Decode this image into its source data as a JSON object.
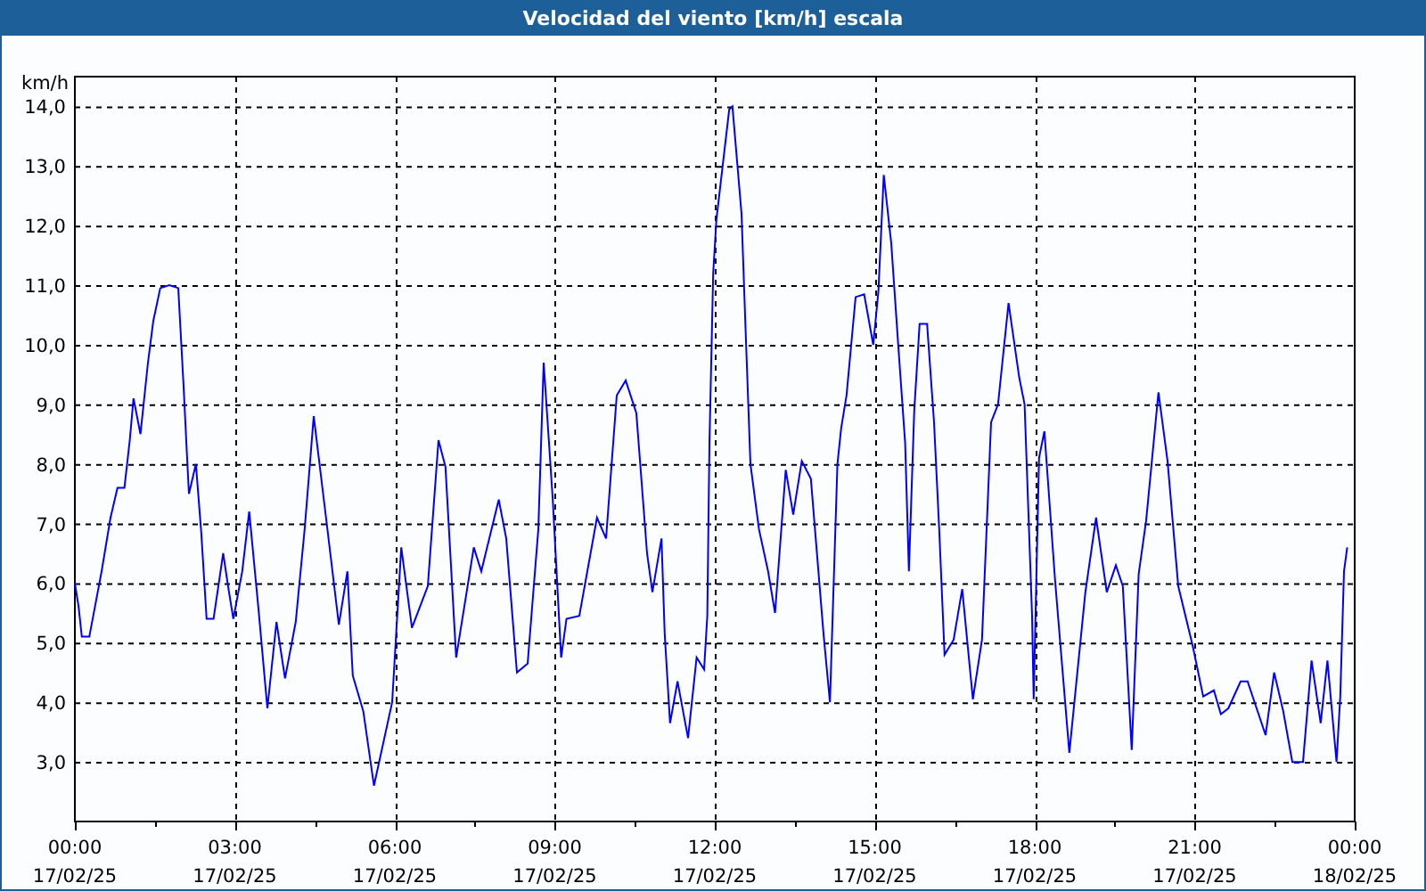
{
  "window": {
    "title": "Velocidad del viento [km/h] escala"
  },
  "chart": {
    "chart_data": {
      "type": "line",
      "ylabel": "km/h",
      "ylim": [
        2,
        14.5
      ],
      "grid": true,
      "xlim": [
        0,
        24
      ],
      "xticks": [
        {
          "value": 0,
          "label": "00:00"
        },
        {
          "value": 3,
          "label": "03:00"
        },
        {
          "value": 6,
          "label": "06:00"
        },
        {
          "value": 9,
          "label": "09:00"
        },
        {
          "value": 12,
          "label": "12:00"
        },
        {
          "value": 15,
          "label": "15:00"
        },
        {
          "value": 18,
          "label": "18:00"
        },
        {
          "value": 21,
          "label": "21:00"
        },
        {
          "value": 24,
          "label": "00:00"
        }
      ],
      "annotations": [
        "17/02/25",
        "17/02/25",
        "17/02/25",
        "17/02/25",
        "17/02/25",
        "17/02/25",
        "17/02/25",
        "17/02/25",
        "18/02/25"
      ],
      "yticks": [
        {
          "value": 3,
          "label": "3,0"
        },
        {
          "value": 4,
          "label": "4,0"
        },
        {
          "value": 5,
          "label": "5,0"
        },
        {
          "value": 6,
          "label": "6,0"
        },
        {
          "value": 7,
          "label": "7,0"
        },
        {
          "value": 8,
          "label": "8,0"
        },
        {
          "value": 9,
          "label": "9,0"
        },
        {
          "value": 10,
          "label": "10,0"
        },
        {
          "value": 11,
          "label": "11,0"
        },
        {
          "value": 12,
          "label": "12,0"
        },
        {
          "value": 13,
          "label": "13,0"
        },
        {
          "value": 14,
          "label": "14,0"
        }
      ],
      "x": [
        0,
        0.07,
        0.13,
        0.27,
        0.5,
        0.67,
        0.8,
        0.93,
        1.03,
        1.1,
        1.23,
        1.37,
        1.47,
        1.6,
        1.77,
        1.94,
        2.04,
        2.1,
        2.14,
        2.27,
        2.37,
        2.47,
        2.6,
        2.78,
        2.88,
        2.97,
        3.14,
        3.27,
        3.44,
        3.61,
        3.78,
        3.94,
        4.14,
        4.31,
        4.48,
        4.71,
        4.95,
        5.11,
        5.21,
        5.41,
        5.61,
        5.95,
        6.12,
        6.32,
        6.62,
        6.82,
        6.95,
        7.15,
        7.48,
        7.62,
        7.95,
        8.09,
        8.29,
        8.49,
        8.69,
        8.79,
        8.96,
        9.12,
        9.22,
        9.46,
        9.79,
        9.96,
        10.16,
        10.33,
        10.53,
        10.73,
        10.83,
        11.0,
        11.06,
        11.16,
        11.3,
        11.5,
        11.66,
        11.8,
        11.86,
        11.9,
        11.97,
        12.03,
        12.27,
        12.33,
        12.5,
        12.57,
        12.67,
        12.83,
        13.0,
        13.13,
        13.33,
        13.47,
        13.63,
        13.8,
        14.04,
        14.16,
        14.3,
        14.37,
        14.47,
        14.64,
        14.8,
        14.97,
        15.07,
        15.17,
        15.31,
        15.44,
        15.57,
        15.64,
        15.74,
        15.84,
        15.98,
        16.11,
        16.21,
        16.31,
        16.48,
        16.64,
        16.84,
        17.01,
        17.18,
        17.31,
        17.51,
        17.71,
        17.81,
        17.95,
        17.98,
        18.08,
        18.18,
        18.38,
        18.65,
        18.95,
        19.15,
        19.35,
        19.52,
        19.65,
        19.82,
        19.95,
        20.09,
        20.32,
        20.49,
        20.69,
        20.96,
        21.16,
        21.36,
        21.49,
        21.63,
        21.86,
        21.99,
        22.33,
        22.49,
        22.66,
        22.83,
        23.03,
        23.19,
        23.36,
        23.49,
        23.66,
        23.73,
        23.8,
        23.86
      ],
      "series": [
        {
          "color": "#0000ff",
          "values": [
            6.0,
            5.6,
            5.1,
            5.1,
            6.2,
            7.1,
            7.6,
            7.6,
            8.4,
            9.1,
            8.5,
            9.7,
            10.4,
            10.95,
            11.0,
            10.95,
            9.3,
            8.2,
            7.5,
            8.0,
            6.85,
            5.4,
            5.4,
            6.5,
            5.9,
            5.4,
            6.2,
            7.2,
            5.6,
            3.9,
            5.35,
            4.4,
            5.35,
            6.9,
            8.8,
            7.1,
            5.3,
            6.2,
            4.45,
            3.85,
            2.6,
            4.0,
            6.6,
            5.25,
            5.95,
            8.4,
            7.95,
            4.75,
            6.6,
            6.2,
            7.4,
            6.75,
            4.5,
            4.65,
            6.9,
            9.7,
            7.4,
            4.75,
            5.4,
            5.45,
            7.1,
            6.75,
            9.15,
            9.4,
            8.85,
            6.5,
            5.85,
            6.75,
            5.15,
            3.65,
            4.35,
            3.4,
            4.75,
            4.55,
            5.45,
            8.35,
            11.2,
            12.1,
            13.95,
            14.0,
            12.2,
            10.4,
            8.0,
            6.9,
            6.2,
            5.5,
            7.9,
            7.15,
            8.05,
            7.75,
            5.15,
            4.0,
            8.0,
            8.6,
            9.15,
            10.8,
            10.85,
            10.0,
            10.9,
            12.85,
            11.7,
            10.0,
            8.35,
            6.2,
            8.9,
            10.35,
            10.35,
            8.7,
            6.9,
            4.8,
            5.05,
            5.9,
            4.05,
            5.05,
            8.7,
            9.0,
            10.7,
            9.45,
            9.0,
            5.45,
            4.05,
            8.1,
            8.55,
            6.05,
            3.15,
            5.85,
            7.1,
            5.85,
            6.3,
            5.95,
            3.2,
            6.15,
            7.05,
            9.2,
            8.05,
            5.95,
            4.95,
            4.1,
            4.2,
            3.8,
            3.9,
            4.35,
            4.35,
            3.45,
            4.5,
            3.85,
            3.0,
            3.0,
            4.7,
            3.65,
            4.7,
            3.0,
            4.1,
            6.2,
            6.6
          ]
        }
      ]
    }
  }
}
